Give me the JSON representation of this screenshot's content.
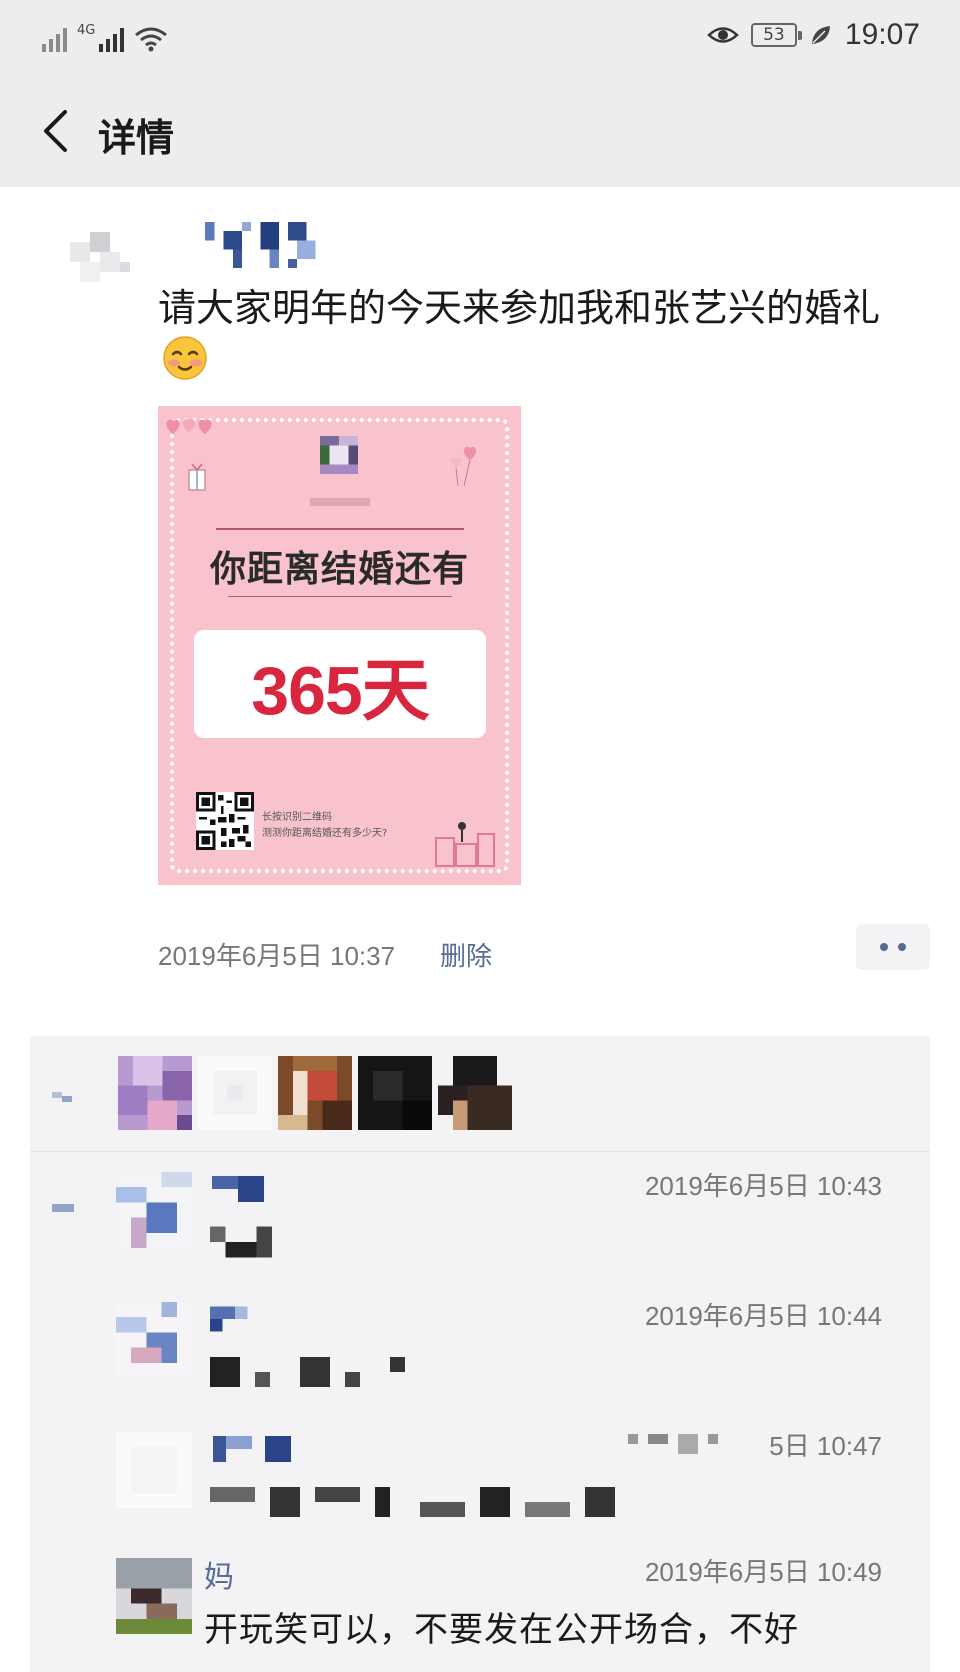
{
  "status_bar": {
    "network_label": "4G",
    "battery_level": "53",
    "time": "19:07"
  },
  "header": {
    "title": "详情"
  },
  "post": {
    "text": "请大家明年的今天来参加我和张艺兴的婚礼",
    "emoji": "smiling-blushing-face",
    "image": {
      "heading": "你距离结婚还有",
      "days": "365天",
      "qr_caption_line1": "长按识别二维码",
      "qr_caption_line2": "测测你距离结婚还有多少天?"
    },
    "timestamp": "2019年6月5日 10:37",
    "delete_label": "删除"
  },
  "likes": {
    "count_visible": 5
  },
  "comments": [
    {
      "name": "",
      "time": "2019年6月5日 10:43",
      "text": ""
    },
    {
      "name": "",
      "time": "2019年6月5日 10:44",
      "text": ""
    },
    {
      "name": "",
      "time": "5日 10:47",
      "text": ""
    },
    {
      "name": "妈",
      "time": "2019年6月5日 10:49",
      "text": "开玩笑可以，不要发在公开场合，不好"
    }
  ],
  "colors": {
    "link_blue": "#576b95",
    "header_bg": "#ededed",
    "panel_bg": "#f3f3f5",
    "image_pink": "#f8c3cc",
    "days_red": "#d7263d"
  }
}
